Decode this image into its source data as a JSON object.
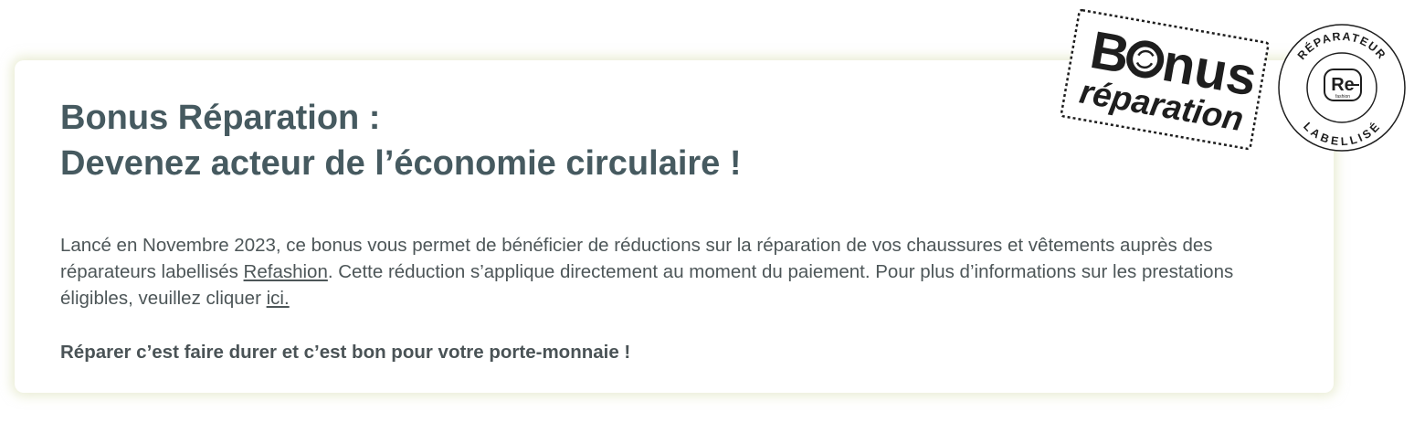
{
  "heading": {
    "line1": "Bonus Réparation :",
    "line2": "Devenez acteur de l’économie circulaire !"
  },
  "intro": {
    "part1": "Lancé en Novembre 2023, ce bonus vous permet de bénéficier de réductions sur la réparation de vos chaussures et vêtements auprès des réparateurs labellisés ",
    "refashion_link": "Refashion",
    "part2": ". Cette réduction s’applique directement au moment du paiement. Pour plus d’informations sur les prestations éligibles, veuillez cliquer  ",
    "here_link": "ici."
  },
  "tagline": "Réparer c’est faire durer et c’est bon pour votre porte-monnaie !",
  "stamp": {
    "word1_start": "B",
    "word1_end": "nus",
    "word2": "réparation"
  },
  "seal": {
    "top_arc": "RÉPARATEUR",
    "bottom_arc": "LABELLISÉ",
    "logo": "Re",
    "logo_sub": "fashion"
  },
  "colors": {
    "heading": "#465a60",
    "body": "#4d5658",
    "card_glow": "#d8deb2"
  }
}
